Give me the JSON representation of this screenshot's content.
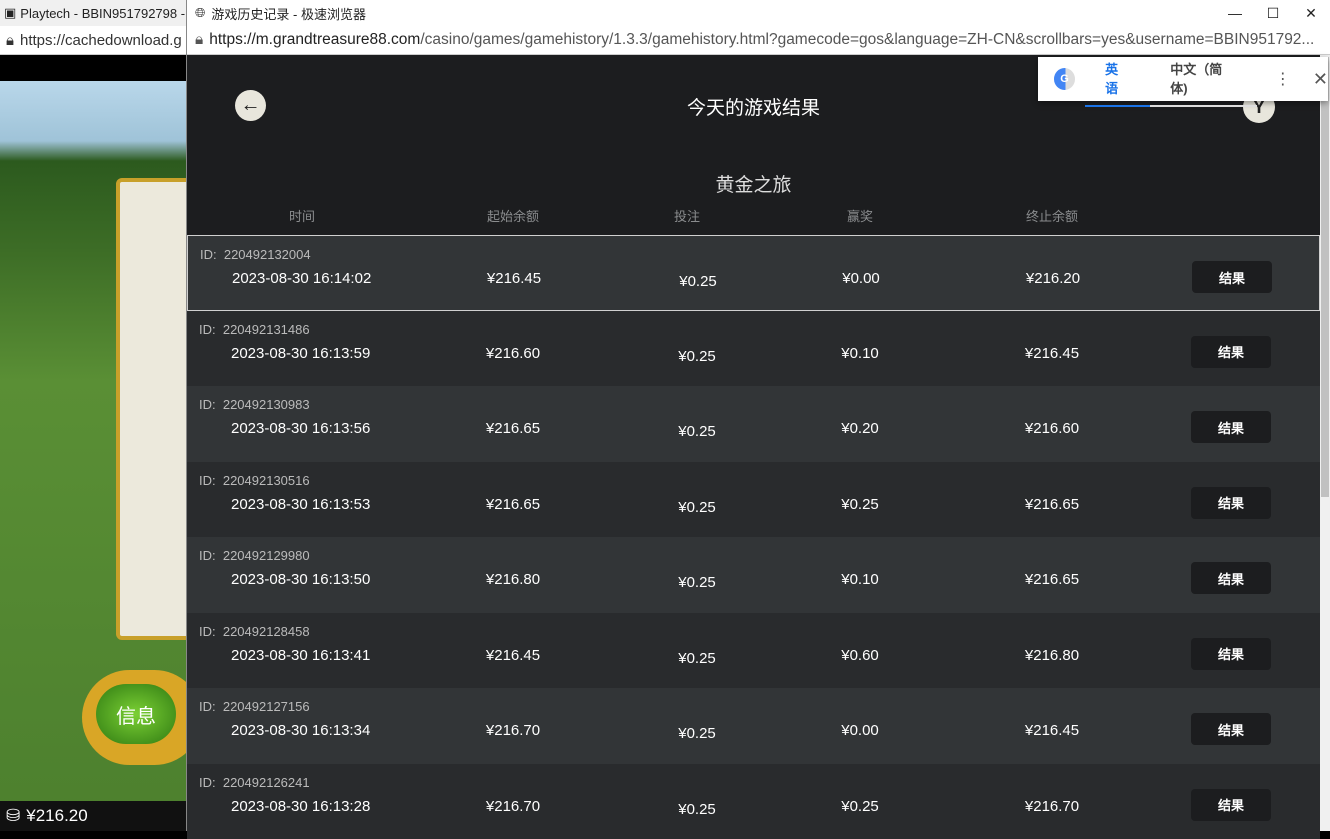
{
  "bg_window": {
    "tab_title": "Playtech - BBIN951792798 -",
    "url": "https://cachedownload.g",
    "info_button": "信息",
    "balance": "¥216.20"
  },
  "window": {
    "title": "游戏历史记录 - 极速浏览器",
    "url_host": "https://m.grandtreasure88.com",
    "url_path": "/casino/games/gamehistory/1.3.3/gamehistory.html?gamecode=gos&language=ZH-CN&scrollbars=yes&username=BBIN951792..."
  },
  "translate": {
    "tab_en": "英语",
    "tab_zh": "中文（简体)"
  },
  "page": {
    "title": "今天的游戏结果",
    "game_name": "黄金之旅",
    "headers": [
      "时间",
      "起始余额",
      "投注",
      "赢奖",
      "终止余额"
    ],
    "result_label": "结果",
    "rows": [
      {
        "id": "220492132004",
        "time": "2023-08-30 16:14:02",
        "start": "¥216.45",
        "bet": "¥0.25",
        "win": "¥0.00",
        "end": "¥216.20"
      },
      {
        "id": "220492131486",
        "time": "2023-08-30 16:13:59",
        "start": "¥216.60",
        "bet": "¥0.25",
        "win": "¥0.10",
        "end": "¥216.45"
      },
      {
        "id": "220492130983",
        "time": "2023-08-30 16:13:56",
        "start": "¥216.65",
        "bet": "¥0.25",
        "win": "¥0.20",
        "end": "¥216.60"
      },
      {
        "id": "220492130516",
        "time": "2023-08-30 16:13:53",
        "start": "¥216.65",
        "bet": "¥0.25",
        "win": "¥0.25",
        "end": "¥216.65"
      },
      {
        "id": "220492129980",
        "time": "2023-08-30 16:13:50",
        "start": "¥216.80",
        "bet": "¥0.25",
        "win": "¥0.10",
        "end": "¥216.65"
      },
      {
        "id": "220492128458",
        "time": "2023-08-30 16:13:41",
        "start": "¥216.45",
        "bet": "¥0.25",
        "win": "¥0.60",
        "end": "¥216.80"
      },
      {
        "id": "220492127156",
        "time": "2023-08-30 16:13:34",
        "start": "¥216.70",
        "bet": "¥0.25",
        "win": "¥0.00",
        "end": "¥216.45"
      },
      {
        "id": "220492126241",
        "time": "2023-08-30 16:13:28",
        "start": "¥216.70",
        "bet": "¥0.25",
        "win": "¥0.25",
        "end": "¥216.70"
      }
    ]
  }
}
